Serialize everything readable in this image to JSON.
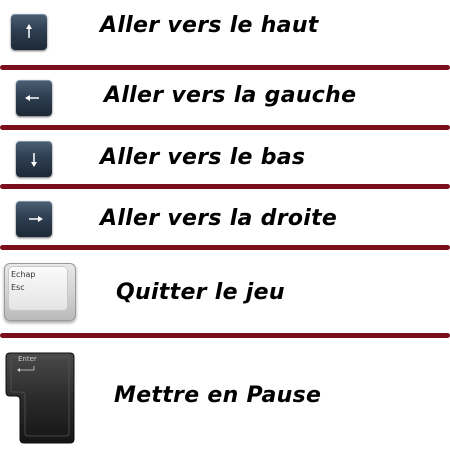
{
  "controls": [
    {
      "key": "up-arrow",
      "icon": "arrow-up-icon",
      "action": "Aller vers le haut"
    },
    {
      "key": "left-arrow",
      "icon": "arrow-left-icon",
      "action": "Aller vers la gauche"
    },
    {
      "key": "down-arrow",
      "icon": "arrow-down-icon",
      "action": "Aller vers le bas"
    },
    {
      "key": "right-arrow",
      "icon": "arrow-right-icon",
      "action": "Aller vers la droite"
    },
    {
      "key": "escape",
      "key_label_top": "Echap",
      "key_label_bottom": "Esc",
      "action": "Quitter le jeu"
    },
    {
      "key": "enter",
      "key_label": "Enter",
      "action": "Mettre en Pause"
    }
  ],
  "colors": {
    "divider": "#7a0e1c",
    "text": "#000000",
    "arrow_key": "#2f3f52",
    "enter_key": "#2b2b2b"
  }
}
